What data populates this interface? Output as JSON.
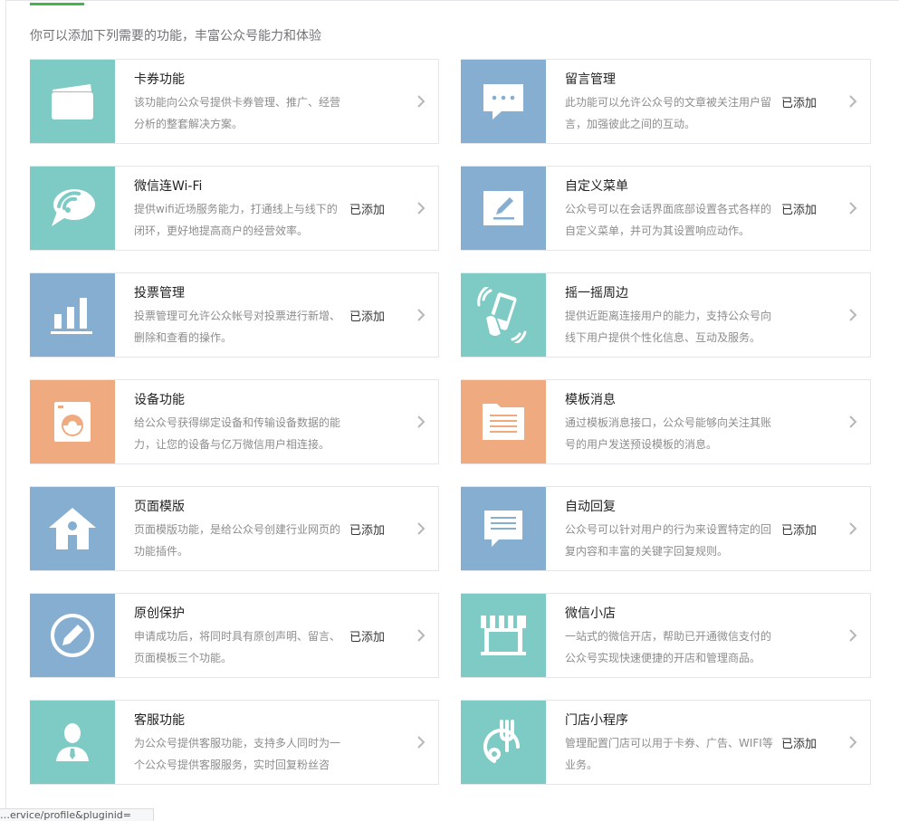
{
  "intro": "你可以添加下列需要的功能，丰富公众号能力和体验",
  "colors": {
    "teal": "#7ecbc5",
    "blue": "#85aed0",
    "orange": "#efab7f",
    "accent_green": "#44b549"
  },
  "status_bar_text": "…ervice/profile&pluginid=",
  "cards": [
    {
      "title": "卡券功能",
      "desc": "该功能向公众号提供卡券管理、推广、经营分析的整套解决方案。",
      "status": "",
      "icon": "card-wallet-icon",
      "color": "#7ecbc5"
    },
    {
      "title": "留言管理",
      "desc": "此功能可以允许公众号的文章被关注用户留言，加强彼此之间的互动。",
      "status": "已添加",
      "icon": "speech-bubble-icon",
      "color": "#85aed0"
    },
    {
      "title": "微信连Wi-Fi",
      "desc": "提供wifi近场服务能力，打通线上与线下的闭环，更好地提高商户的经营效率。",
      "status": "已添加",
      "icon": "wifi-icon",
      "color": "#7ecbc5"
    },
    {
      "title": "自定义菜单",
      "desc": "公众号可以在会话界面底部设置各式各样的自定义菜单，并可为其设置响应动作。",
      "status": "已添加",
      "icon": "edit-menu-icon",
      "color": "#85aed0"
    },
    {
      "title": "投票管理",
      "desc": "投票管理可允许公众帐号对投票进行新增、删除和查看的操作。",
      "status": "已添加",
      "icon": "bar-chart-icon",
      "color": "#85aed0"
    },
    {
      "title": "摇一摇周边",
      "desc": "提供近距离连接用户的能力，支持公众号向线下用户提供个性化信息、互动及服务。",
      "status": "",
      "icon": "shake-phone-icon",
      "color": "#7ecbc5"
    },
    {
      "title": "设备功能",
      "desc": "给公众号获得绑定设备和传输设备数据的能力，让您的设备与亿万微信用户相连接。",
      "status": "",
      "icon": "washing-machine-icon",
      "color": "#efab7f"
    },
    {
      "title": "模板消息",
      "desc": "通过模板消息接口，公众号能够向关注其账号的用户发送预设模板的消息。",
      "status": "",
      "icon": "folder-template-icon",
      "color": "#efab7f"
    },
    {
      "title": "页面模版",
      "desc": "页面模版功能，是给公众号创建行业网页的功能插件。",
      "status": "已添加",
      "icon": "house-icon",
      "color": "#85aed0"
    },
    {
      "title": "自动回复",
      "desc": "公众号可以针对用户的行为来设置特定的回复内容和丰富的关键字回复规则。",
      "status": "已添加",
      "icon": "auto-reply-icon",
      "color": "#85aed0"
    },
    {
      "title": "原创保护",
      "desc": "申请成功后，将同时具有原创声明、留言、页面模板三个功能。",
      "status": "已添加",
      "icon": "pen-circle-icon",
      "color": "#85aed0"
    },
    {
      "title": "微信小店",
      "desc": "一站式的微信开店，帮助已开通微信支付的公众号实现快速便捷的开店和管理商品。",
      "status": "",
      "icon": "storefront-icon",
      "color": "#7ecbc5"
    },
    {
      "title": "客服功能",
      "desc": "为公众号提供客服功能，支持多人同时为一个公众号提供客服服务，实时回复粉丝咨",
      "status": "",
      "icon": "customer-service-icon",
      "color": "#7ecbc5"
    },
    {
      "title": "门店小程序",
      "desc": "管理配置门店可以用于卡券、广告、WIFI等业务。",
      "status": "已添加",
      "icon": "store-locator-icon",
      "color": "#7ecbc5"
    }
  ]
}
